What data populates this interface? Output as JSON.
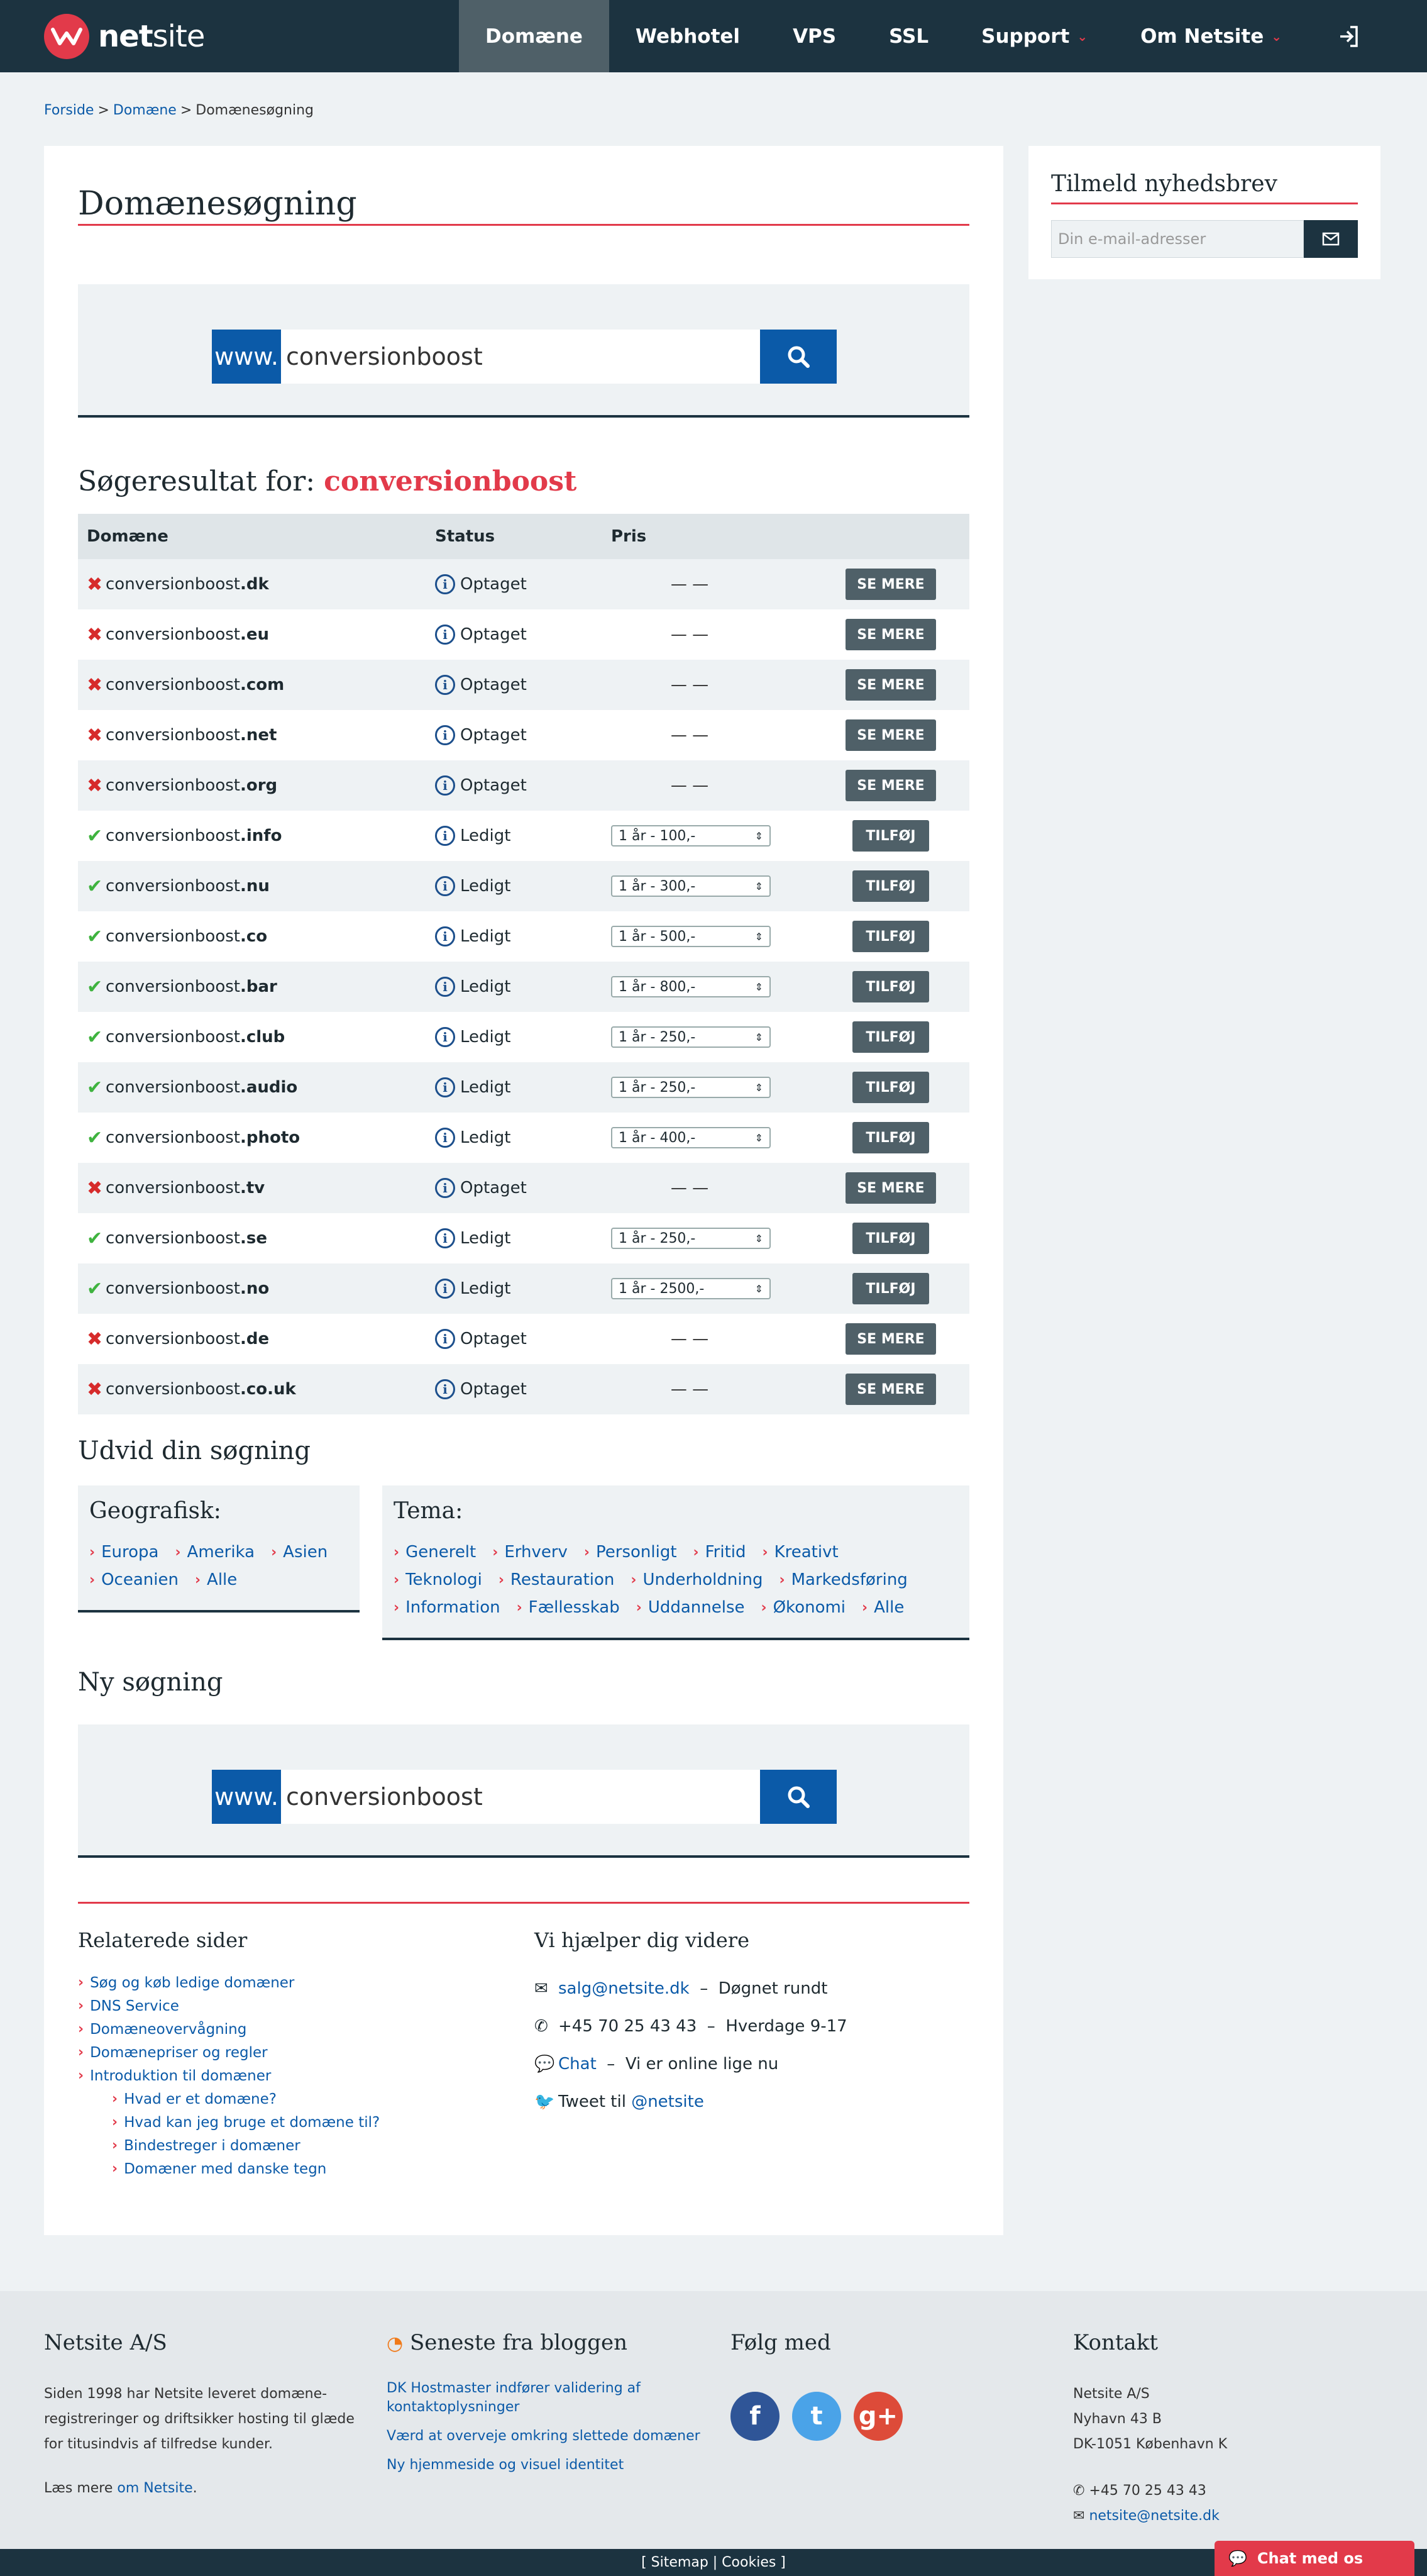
{
  "header": {
    "logo_text_bold": "net",
    "logo_text_rest": "site",
    "nav": [
      {
        "label": "Domæne",
        "active": true
      },
      {
        "label": "Webhotel"
      },
      {
        "label": "VPS"
      },
      {
        "label": "SSL"
      },
      {
        "label": "Support",
        "dropdown": true
      },
      {
        "label": "Om Netsite",
        "dropdown": true
      }
    ],
    "login_icon": "sign-in-icon"
  },
  "breadcrumb": {
    "items": [
      "Forside",
      "Domæne",
      "Domænesøgning"
    ],
    "sep": ">"
  },
  "main": {
    "title": "Domænesøgning",
    "search": {
      "prefix": "www.",
      "value": "conversionboost"
    },
    "results_label": "Søgeresultat for:",
    "results_query": "conversionboost",
    "table": {
      "headers": [
        "Domæne",
        "Status",
        "Pris",
        ""
      ],
      "rows": [
        {
          "name": "conversionboost",
          "tld": ".dk",
          "available": false,
          "status": "Optaget",
          "price": "— —",
          "action": "SE MERE"
        },
        {
          "name": "conversionboost",
          "tld": ".eu",
          "available": false,
          "status": "Optaget",
          "price": "— —",
          "action": "SE MERE"
        },
        {
          "name": "conversionboost",
          "tld": ".com",
          "available": false,
          "status": "Optaget",
          "price": "— —",
          "action": "SE MERE"
        },
        {
          "name": "conversionboost",
          "tld": ".net",
          "available": false,
          "status": "Optaget",
          "price": "— —",
          "action": "SE MERE"
        },
        {
          "name": "conversionboost",
          "tld": ".org",
          "available": false,
          "status": "Optaget",
          "price": "— —",
          "action": "SE MERE"
        },
        {
          "name": "conversionboost",
          "tld": ".info",
          "available": true,
          "status": "Ledigt",
          "price": "1 år - 100,-",
          "action": "TILFØJ"
        },
        {
          "name": "conversionboost",
          "tld": ".nu",
          "available": true,
          "status": "Ledigt",
          "price": "1 år - 300,-",
          "action": "TILFØJ"
        },
        {
          "name": "conversionboost",
          "tld": ".co",
          "available": true,
          "status": "Ledigt",
          "price": "1 år - 500,-",
          "action": "TILFØJ"
        },
        {
          "name": "conversionboost",
          "tld": ".bar",
          "available": true,
          "status": "Ledigt",
          "price": "1 år - 800,-",
          "action": "TILFØJ"
        },
        {
          "name": "conversionboost",
          "tld": ".club",
          "available": true,
          "status": "Ledigt",
          "price": "1 år - 250,-",
          "action": "TILFØJ"
        },
        {
          "name": "conversionboost",
          "tld": ".audio",
          "available": true,
          "status": "Ledigt",
          "price": "1 år - 250,-",
          "action": "TILFØJ"
        },
        {
          "name": "conversionboost",
          "tld": ".photo",
          "available": true,
          "status": "Ledigt",
          "price": "1 år - 400,-",
          "action": "TILFØJ"
        },
        {
          "name": "conversionboost",
          "tld": ".tv",
          "available": false,
          "status": "Optaget",
          "price": "— —",
          "action": "SE MERE"
        },
        {
          "name": "conversionboost",
          "tld": ".se",
          "available": true,
          "status": "Ledigt",
          "price": "1 år - 250,-",
          "action": "TILFØJ"
        },
        {
          "name": "conversionboost",
          "tld": ".no",
          "available": true,
          "status": "Ledigt",
          "price": "1 år - 2500,-",
          "action": "TILFØJ"
        },
        {
          "name": "conversionboost",
          "tld": ".de",
          "available": false,
          "status": "Optaget",
          "price": "— —",
          "action": "SE MERE"
        },
        {
          "name": "conversionboost",
          "tld": ".co.uk",
          "available": false,
          "status": "Optaget",
          "price": "— —",
          "action": "SE MERE"
        }
      ]
    },
    "expand": {
      "title": "Udvid din søgning",
      "geo": {
        "title": "Geografisk:",
        "links": [
          "Europa",
          "Amerika",
          "Asien",
          "Oceanien",
          "Alle"
        ]
      },
      "tema": {
        "title": "Tema:",
        "links": [
          "Generelt",
          "Erhverv",
          "Personligt",
          "Fritid",
          "Kreativt",
          "Teknologi",
          "Restauration",
          "Underholdning",
          "Markedsføring",
          "Information",
          "Fællesskab",
          "Uddannelse",
          "Økonomi",
          "Alle"
        ]
      }
    },
    "new_search": {
      "title": "Ny søgning",
      "prefix": "www.",
      "value": "conversionboost"
    },
    "related": {
      "title": "Relaterede sider",
      "links": [
        {
          "label": "Søg og køb ledige domæner",
          "sub": false
        },
        {
          "label": "DNS Service",
          "sub": false
        },
        {
          "label": "Domæneovervågning",
          "sub": false
        },
        {
          "label": "Domænepriser og regler",
          "sub": false
        },
        {
          "label": "Introduktion til domæner",
          "sub": false
        },
        {
          "label": "Hvad er et domæne?",
          "sub": true
        },
        {
          "label": "Hvad kan jeg bruge et domæne til?",
          "sub": true
        },
        {
          "label": "Bindestreger i domæner",
          "sub": true
        },
        {
          "label": "Domæner med danske tegn",
          "sub": true
        }
      ]
    },
    "help": {
      "title": "Vi hjælper dig videre",
      "email": "salg@netsite.dk",
      "email_note": "Døgnet rundt",
      "phone": "+45 70 25 43 43",
      "phone_note": "Hverdage 9-17",
      "chat": "Chat",
      "chat_note": "Vi er online lige nu",
      "twitter_prefix": "Tweet til",
      "twitter_handle": "@netsite",
      "dash": "–"
    }
  },
  "sidebar": {
    "title": "Tilmeld nyhedsbrev",
    "placeholder": "Din e-mail-adresser"
  },
  "footer": {
    "about": {
      "title": "Netsite A/S",
      "text": "Siden 1998 har Netsite leveret domæne-registreringer og driftsikker hosting til glæde for titusindvis af tilfredse kunder.",
      "more_prefix": "Læs mere",
      "more_link": "om Netsite",
      "more_suffix": "."
    },
    "blog": {
      "title": "Seneste fra bloggen",
      "posts": [
        "DK Hostmaster indfører validering af kontaktoplysninger",
        "Værd at overveje omkring slettede domæner",
        "Ny hjemmeside og visuel identitet"
      ]
    },
    "follow": {
      "title": "Følg med",
      "icons": [
        {
          "name": "facebook-icon",
          "glyph": "f",
          "color": "#2f5597"
        },
        {
          "name": "twitter-icon",
          "glyph": "t",
          "color": "#4aa3e8"
        },
        {
          "name": "google-plus-icon",
          "glyph": "g+",
          "color": "#dd4b39"
        }
      ]
    },
    "contact": {
      "title": "Kontakt",
      "lines": [
        "Netsite A/S",
        "Nyhavn 43 B",
        "DK-1051 København K"
      ],
      "phone": "+45 70 25 43 43",
      "email": "netsite@netsite.dk"
    },
    "bottom": "[ Sitemap | Cookies ]",
    "chat_button": "Chat med os"
  },
  "colors": {
    "brand": "#1c3340",
    "accent": "#e23a4a",
    "link": "#0b5aa8",
    "button": "#4f6068"
  }
}
